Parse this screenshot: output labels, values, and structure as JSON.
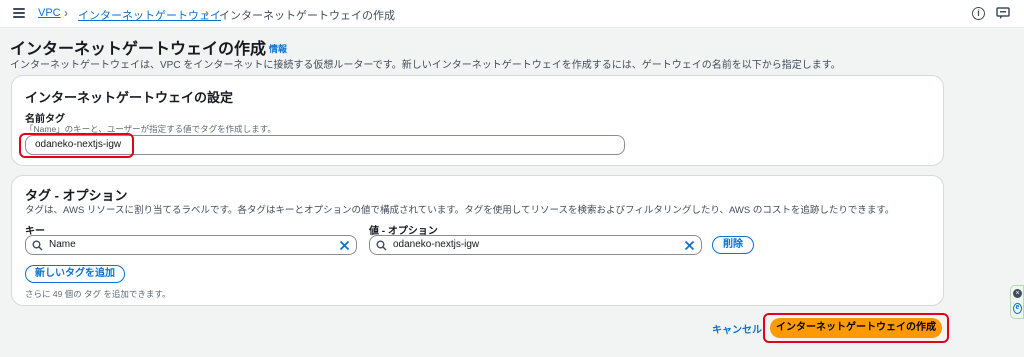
{
  "breadcrumb": {
    "items": [
      "VPC",
      "インターネットゲートウェイ",
      "インターネットゲートウェイの作成"
    ]
  },
  "header": {
    "title": "インターネットゲートウェイの作成",
    "info_link": "情報",
    "description": "インターネットゲートウェイは、VPC をインターネットに接続する仮想ルーターです。新しいインターネットゲートウェイを作成するには、ゲートウェイの名前を以下から指定します。"
  },
  "settings": {
    "heading": "インターネットゲートウェイの設定",
    "name_tag_label": "名前タグ",
    "name_tag_hint": "「Name」のキーと、ユーザーが指定する値でタグを作成します。",
    "name_tag_value": "odaneko-nextjs-igw"
  },
  "tags": {
    "heading": "タグ - オプション",
    "description": "タグは、AWS リソースに割り当てるラベルです。各タグはキーとオプションの値で構成されています。タグを使用してリソースを検索およびフィルタリングしたり、AWS のコストを追跡したりできます。",
    "key_label": "キー",
    "value_label": "値 - オプション",
    "rows": [
      {
        "key": "Name",
        "value": "odaneko-nextjs-igw",
        "remove_label": "削除"
      }
    ],
    "add_button": "新しいタグを追加",
    "remaining_hint": "さらに 49 個の タグ を追加できます。"
  },
  "footer": {
    "cancel_label": "キャンセル",
    "create_label": "インターネットゲートウェイの作成"
  },
  "colors": {
    "primary": "#ff9900",
    "link": "#0972d3",
    "highlight": "#e3001b"
  }
}
